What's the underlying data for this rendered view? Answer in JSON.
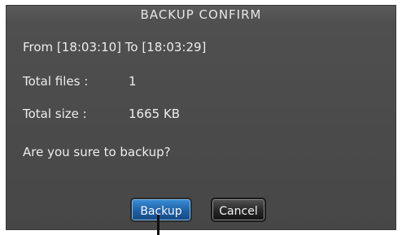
{
  "dialog": {
    "title": "BACKUP CONFIRM",
    "range_text": "From [18:03:10] To [18:03:29]",
    "total_files_label": "Total files :",
    "total_files_value": "1",
    "total_size_label": "Total size :",
    "total_size_value": "1665 KB",
    "question": "Are you sure to backup?",
    "backup_label": "Backup",
    "cancel_label": "Cancel"
  }
}
